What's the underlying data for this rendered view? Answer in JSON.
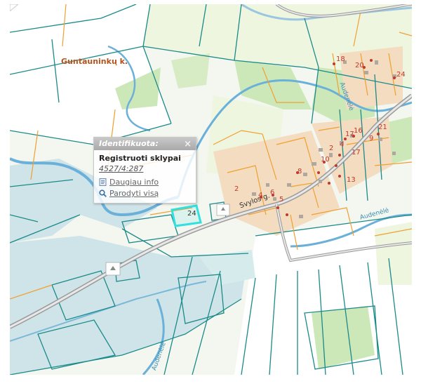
{
  "map": {
    "village_label": "Guntauninkų k.",
    "road_label": "Svylos g.",
    "river_labels": [
      "Audenėlė",
      "Audenėlė",
      "Audenėlė"
    ],
    "house_numbers": [
      "18",
      "20",
      "24",
      "17",
      "16",
      "4",
      "2",
      "21",
      "9",
      "10",
      "17",
      "13",
      "8",
      "2",
      "4",
      "6",
      "5",
      "24"
    ],
    "highlighted_parcel_number": "24",
    "colors": {
      "parcel_boundary": "#1a8a8a",
      "cadastral_boundary": "#f0a030",
      "river": "#6ab0d8",
      "water_area": "#cfe4e8",
      "meadow": "#eef6e0",
      "forest": "#cde8b8",
      "settlement": "#f3dcc0",
      "highlight": "#33e0e0",
      "road": "#8c8c8c"
    }
  },
  "popup": {
    "title": "Identifikuota:",
    "close_symbol": "×",
    "layer_name": "Registruoti sklypai",
    "parcel_id": "4527/4:287",
    "more_info": "Daugiau info",
    "show_all": "Parodyti visą"
  }
}
